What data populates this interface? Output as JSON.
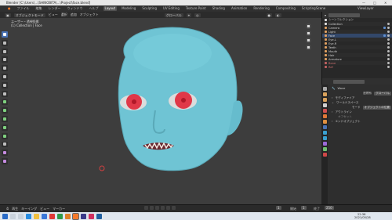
{
  "window": {
    "title": "Blender [C:\\Users\\...\\SHINOBITA\\...\\Project\\face.blend]",
    "controls": [
      "—",
      "□",
      "✕"
    ]
  },
  "menubar": {
    "menus": [
      "ファイル",
      "編集",
      "レンダー",
      "ウィンドウ",
      "ヘルプ"
    ],
    "tabs": [
      "Layout",
      "Modeling",
      "Sculpting",
      "UV Editing",
      "Texture Paint",
      "Shading",
      "Animation",
      "Rendering",
      "Compositing",
      "Scripting"
    ],
    "active_tab": "Layout",
    "scene_label": "Scene",
    "viewlayer_label": "ViewLayer"
  },
  "viewport_header": {
    "mode": "オブジェクトモード",
    "menus": [
      "ビュー",
      "選択",
      "追加",
      "オブジェクト"
    ],
    "global": "グローバル"
  },
  "viewport": {
    "info_line1": "ユーザー・透視投影",
    "info_line2": "(1) Collection | Face"
  },
  "outliner": {
    "title": "シーンコレクション",
    "items": [
      {
        "label": "Collection",
        "color": "#e0e0e0"
      },
      {
        "label": "Camera",
        "color": "#e0a060"
      },
      {
        "label": "Light",
        "color": "#e0a060"
      },
      {
        "label": "Face",
        "color": "#e0a060"
      },
      {
        "label": "Eye.L",
        "color": "#e0a060"
      },
      {
        "label": "Eye.R",
        "color": "#e0a060"
      },
      {
        "label": "Teeth",
        "color": "#e0a060"
      },
      {
        "label": "Mouth",
        "color": "#e0a060"
      },
      {
        "label": "Hair",
        "color": "#e0a060"
      },
      {
        "label": "Armature",
        "color": "#e0a060"
      },
      {
        "label": "Bone",
        "color": "#c06060"
      },
      {
        "label": "Ref",
        "color": "#c06060"
      }
    ]
  },
  "properties": {
    "object_name": "Wave",
    "mode_label": "座標系",
    "mode_value": "グローバル",
    "sections": [
      "モディファイア",
      "ワールドスペース",
      "アウトライン",
      "オフセット"
    ],
    "field_label": "モード",
    "field_value": "オブジェクトの位置",
    "footer": "エンドオブジェクト"
  },
  "timeline": {
    "menus": [
      "再生",
      "キーイング",
      "ビュー",
      "マーカー"
    ],
    "frame_label": "1",
    "start_label": "開始",
    "start_value": "1",
    "end_label": "終了",
    "end_value": "250"
  },
  "taskbar": {
    "time": "22:38",
    "date": "2021/05/28"
  },
  "colors": {
    "skin": "#6fc4d4",
    "eye": "#e03848",
    "accent": "#4a73b5"
  }
}
